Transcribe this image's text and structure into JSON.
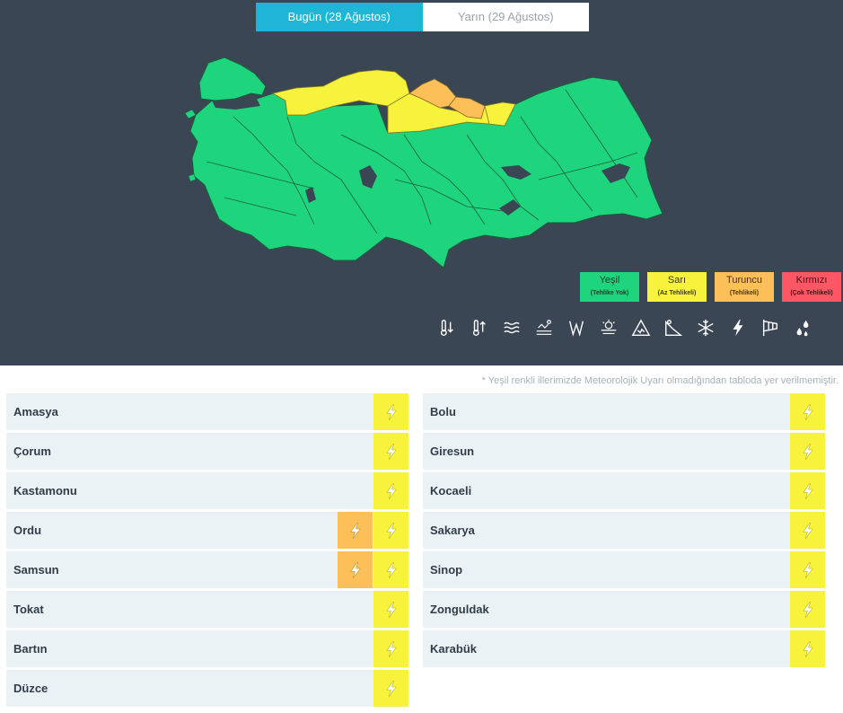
{
  "tabs": [
    {
      "label": "Bugün (28 Ağustos)",
      "active": true
    },
    {
      "label": "Yarın (29 Ağustos)",
      "active": false
    }
  ],
  "legend": [
    {
      "title": "Yeşil",
      "sub": "(Tehlike Yok)",
      "color": "#1ed57e"
    },
    {
      "title": "Sarı",
      "sub": "(Az Tehlikeli)",
      "color": "#f7f23b"
    },
    {
      "title": "Turuncu",
      "sub": "(Tehlikeli)",
      "color": "#fdbf57"
    },
    {
      "title": "Kırmızı",
      "sub": "(Çok Tehlikeli)",
      "color": "#fd5665"
    }
  ],
  "hazard_icons": [
    "cold-icon",
    "heat-icon",
    "fog-icon",
    "dust-icon",
    "wind-icon",
    "sand-storm-icon",
    "avalanche-icon",
    "ice-icon",
    "snow-icon",
    "thunderstorm-icon",
    "wind-sock-icon",
    "rain-icon"
  ],
  "note": "* Yeşil renkli illerimizde Meteorolojik Uyarı olmadığından tabloda yer verilmemiştir.",
  "left_list": [
    {
      "name": "Amasya",
      "levels": [
        "yellow"
      ]
    },
    {
      "name": "Çorum",
      "levels": [
        "yellow"
      ]
    },
    {
      "name": "Kastamonu",
      "levels": [
        "yellow"
      ]
    },
    {
      "name": "Ordu",
      "levels": [
        "orange",
        "yellow"
      ]
    },
    {
      "name": "Samsun",
      "levels": [
        "orange",
        "yellow"
      ]
    },
    {
      "name": "Tokat",
      "levels": [
        "yellow"
      ]
    },
    {
      "name": "Bartın",
      "levels": [
        "yellow"
      ]
    },
    {
      "name": "Düzce",
      "levels": [
        "yellow"
      ]
    }
  ],
  "right_list": [
    {
      "name": "Bolu",
      "levels": [
        "yellow"
      ]
    },
    {
      "name": "Giresun",
      "levels": [
        "yellow"
      ]
    },
    {
      "name": "Kocaeli",
      "levels": [
        "yellow"
      ]
    },
    {
      "name": "Sakarya",
      "levels": [
        "yellow"
      ]
    },
    {
      "name": "Sinop",
      "levels": [
        "yellow"
      ]
    },
    {
      "name": "Zonguldak",
      "levels": [
        "yellow"
      ]
    },
    {
      "name": "Karabük",
      "levels": [
        "yellow"
      ]
    }
  ],
  "colors": {
    "green": "#1ed57e",
    "yellow": "#f7f23b",
    "orange": "#fdbf57",
    "red": "#fd5665",
    "tab_active": "#1fb5d6",
    "bg_dark": "#3b4655"
  }
}
